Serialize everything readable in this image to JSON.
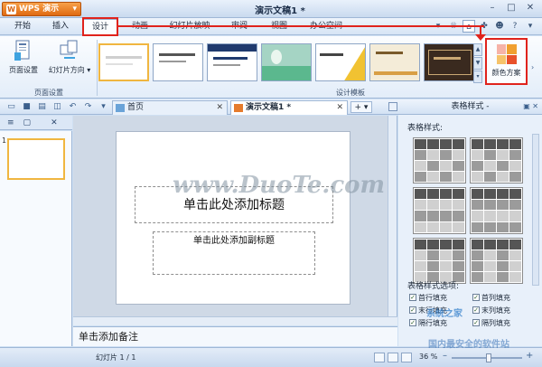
{
  "app": {
    "name": "WPS 演示",
    "doc_title": "演示文稿1 *"
  },
  "menu": {
    "tabs": [
      {
        "label": "开始"
      },
      {
        "label": "插入"
      },
      {
        "label": "设计"
      },
      {
        "label": "动画"
      },
      {
        "label": "幻灯片放映"
      },
      {
        "label": "审阅"
      },
      {
        "label": "视图"
      },
      {
        "label": "办公空间"
      }
    ],
    "active": "设计"
  },
  "ribbon": {
    "page_setup": "页面设置",
    "slide_orientation": "幻灯片方向",
    "group_page_setup": "页面设置",
    "group_design_template": "设计模板",
    "color_scheme": "颜色方案"
  },
  "doc_tabs": [
    {
      "label": "首页"
    },
    {
      "label": "演示文稿1 *"
    }
  ],
  "slides_pane": {
    "slide_number": "1"
  },
  "slide": {
    "title_placeholder": "单击此处添加标题",
    "subtitle_placeholder": "单击此处添加副标题",
    "watermark": "www.DuoTe.com"
  },
  "notes": {
    "placeholder": "单击添加备注"
  },
  "right_panel": {
    "header": "表格样式 -",
    "table_styles_label": "表格样式:",
    "options_label": "表格样式选项:",
    "options": [
      {
        "label": "首行填充",
        "checked": true
      },
      {
        "label": "首列填充",
        "checked": true
      },
      {
        "label": "末行填充",
        "checked": true
      },
      {
        "label": "末列填充",
        "checked": true
      },
      {
        "label": "隔行填充",
        "checked": true
      },
      {
        "label": "隔列填充",
        "checked": true
      }
    ]
  },
  "status": {
    "slide": "幻灯片 1 / 1",
    "zoom": "36 %"
  },
  "watermarks": {
    "site": "系统之家",
    "corner": "国内最安全的软件站"
  },
  "colors": {
    "accent_red": "#e0231c",
    "selected_border": "#f0b640",
    "app_orange": "#e06a12"
  }
}
